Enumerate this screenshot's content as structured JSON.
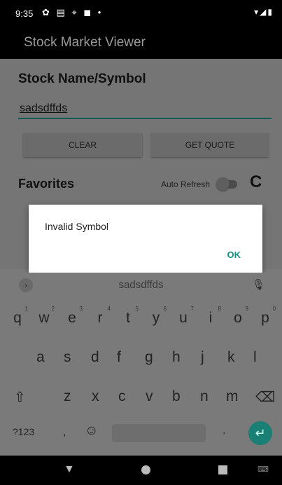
{
  "status_bar": {
    "time": "9:35",
    "left_icons": "✿ ▤ ⌖ ◼ •",
    "right_icons": "▾◢▮"
  },
  "app": {
    "title": "Stock Market Viewer"
  },
  "form": {
    "section_label": "Stock Name/Symbol",
    "input_value": "sadsdffds",
    "clear_label": "CLEAR",
    "get_quote_label": "GET QUOTE"
  },
  "favorites": {
    "label": "Favorites",
    "auto_refresh_label": "Auto Refresh",
    "auto_refresh_on": false,
    "refresh_icon": "C"
  },
  "dialog": {
    "message": "Invalid Symbol",
    "ok_label": "OK"
  },
  "suggestions": {
    "expand_icon": "›",
    "word": "sadsdffds",
    "mic_icon": "🎙"
  },
  "keyboard": {
    "row1": [
      {
        "key": "q",
        "hint": "1"
      },
      {
        "key": "w",
        "hint": "2"
      },
      {
        "key": "e",
        "hint": "3"
      },
      {
        "key": "r",
        "hint": "4"
      },
      {
        "key": "t",
        "hint": "5"
      },
      {
        "key": "y",
        "hint": "6"
      },
      {
        "key": "u",
        "hint": "7"
      },
      {
        "key": "i",
        "hint": "8"
      },
      {
        "key": "o",
        "hint": "9"
      },
      {
        "key": "p",
        "hint": "0"
      }
    ],
    "row2": [
      "a",
      "s",
      "d",
      "f",
      "g",
      "h",
      "j",
      "k",
      "l"
    ],
    "row3": [
      "⇧",
      "z",
      "x",
      "c",
      "v",
      "b",
      "n",
      "m",
      "⌫"
    ],
    "symbols_label": "?123",
    "comma": ",",
    "emoji": "☺",
    "period": ".",
    "enter_icon": "↵"
  },
  "nav_bar": {
    "back_icon": "▼",
    "keyboard_icon": "⌨"
  }
}
